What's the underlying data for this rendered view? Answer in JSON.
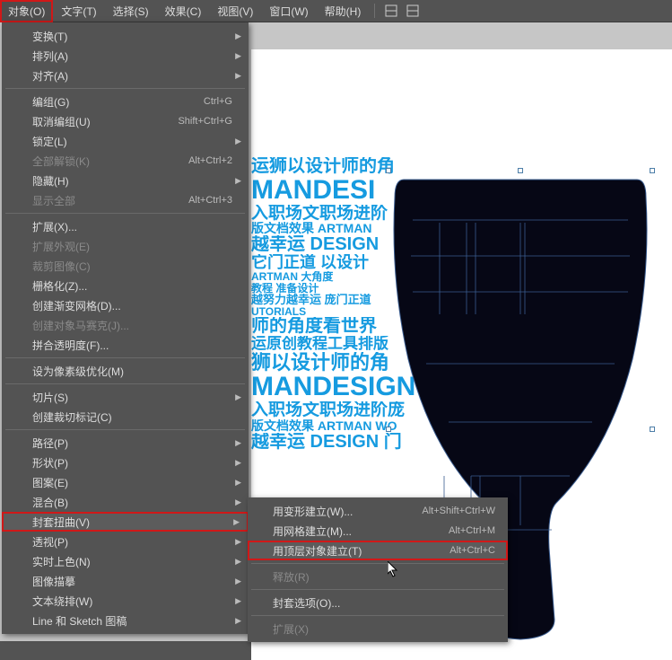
{
  "menubar": {
    "items": [
      {
        "label": "对象(O)",
        "active": true
      },
      {
        "label": "文字(T)"
      },
      {
        "label": "选择(S)"
      },
      {
        "label": "效果(C)"
      },
      {
        "label": "视图(V)"
      },
      {
        "label": "窗口(W)"
      },
      {
        "label": "帮助(H)"
      }
    ]
  },
  "dropdown": {
    "groups": [
      [
        {
          "label": "变换(T)",
          "sub": true
        },
        {
          "label": "排列(A)",
          "sub": true
        },
        {
          "label": "对齐(A)",
          "sub": true
        }
      ],
      [
        {
          "label": "编组(G)",
          "shortcut": "Ctrl+G"
        },
        {
          "label": "取消编组(U)",
          "shortcut": "Shift+Ctrl+G"
        },
        {
          "label": "锁定(L)",
          "sub": true
        },
        {
          "label": "全部解锁(K)",
          "shortcut": "Alt+Ctrl+2",
          "disabled": true
        },
        {
          "label": "隐藏(H)",
          "sub": true
        },
        {
          "label": "显示全部",
          "shortcut": "Alt+Ctrl+3",
          "disabled": true
        }
      ],
      [
        {
          "label": "扩展(X)..."
        },
        {
          "label": "扩展外观(E)",
          "disabled": true
        },
        {
          "label": "裁剪图像(C)",
          "disabled": true
        },
        {
          "label": "栅格化(Z)..."
        },
        {
          "label": "创建渐变网格(D)..."
        },
        {
          "label": "创建对象马赛克(J)...",
          "disabled": true
        },
        {
          "label": "拼合透明度(F)..."
        }
      ],
      [
        {
          "label": "设为像素级优化(M)"
        }
      ],
      [
        {
          "label": "切片(S)",
          "sub": true
        },
        {
          "label": "创建裁切标记(C)"
        }
      ],
      [
        {
          "label": "路径(P)",
          "sub": true
        },
        {
          "label": "形状(P)",
          "sub": true
        },
        {
          "label": "图案(E)",
          "sub": true
        },
        {
          "label": "混合(B)",
          "sub": true
        },
        {
          "label": "封套扭曲(V)",
          "sub": true,
          "highlighted": true
        },
        {
          "label": "透视(P)",
          "sub": true
        },
        {
          "label": "实时上色(N)",
          "sub": true
        },
        {
          "label": "图像描摹",
          "sub": true
        },
        {
          "label": "文本绕排(W)",
          "sub": true
        },
        {
          "label": "Line 和 Sketch 图稿",
          "sub": true
        }
      ]
    ]
  },
  "submenu": {
    "items": [
      {
        "label": "用变形建立(W)...",
        "shortcut": "Alt+Shift+Ctrl+W"
      },
      {
        "label": "用网格建立(M)...",
        "shortcut": "Alt+Ctrl+M"
      },
      {
        "label": "用顶层对象建立(T)",
        "shortcut": "Alt+Ctrl+C",
        "highlighted": true
      },
      {
        "label": "释放(R)",
        "disabled": true,
        "sep_before": true
      },
      {
        "label": "封套选项(O)...",
        "sep_before": true
      },
      {
        "label": "扩展(X)",
        "disabled": true,
        "sep_before": true
      }
    ]
  },
  "canvas": {
    "text_rows": [
      {
        "t": "运狮以设计师的角",
        "s": 20
      },
      {
        "t": "MANDESI",
        "s": 30
      },
      {
        "t": "入职场文职场进阶",
        "s": 19
      },
      {
        "t": "版文档效果 ARTMAN",
        "s": 14
      },
      {
        "t": "越幸运 DESIGN",
        "s": 20
      },
      {
        "t": "它门正道 以设计",
        "s": 18
      },
      {
        "t": "ARTMAN 大角度",
        "s": 12
      },
      {
        "t": "教程 准备设计",
        "s": 12
      },
      {
        "t": "越努力越幸运 庞门正道",
        "s": 13
      },
      {
        "t": "UTORIALS",
        "s": 12
      },
      {
        "t": "师的角度看世界",
        "s": 20
      },
      {
        "t": "运原创教程工具排版",
        "s": 17
      },
      {
        "t": "狮以设计师的角",
        "s": 22
      },
      {
        "t": "MANDESIGN",
        "s": 30
      },
      {
        "t": "入职场文职场进阶庞",
        "s": 19
      },
      {
        "t": "版文档效果 ARTMAN WO",
        "s": 14
      },
      {
        "t": "越幸运 DESIGN 门",
        "s": 20
      }
    ]
  }
}
